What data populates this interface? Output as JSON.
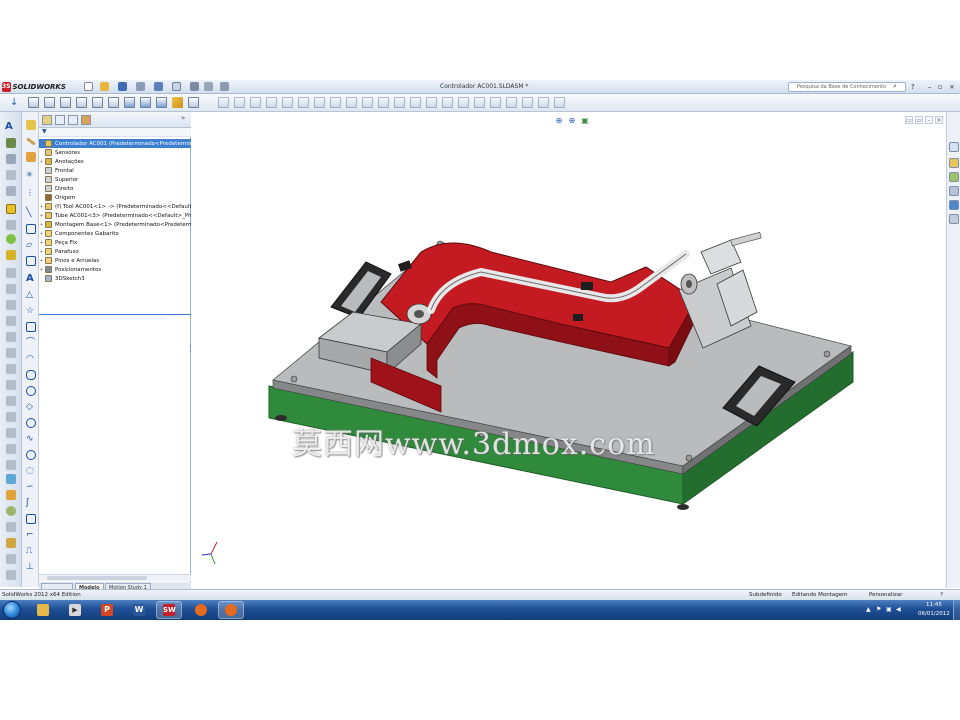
{
  "app": {
    "name": "SOLIDWORKS",
    "document_title": "Controlador AC001.SLDASM *",
    "search_placeholder": "Pesquisa da Base de Conhecimento",
    "help_label": "?"
  },
  "feature_tree": {
    "items": [
      {
        "label": "Controlador AC001  (Predeterminado<Predeterminado",
        "icon": "assembly-icon",
        "selected": true,
        "expand": ""
      },
      {
        "label": "Sensores",
        "icon": "sensors-folder-icon",
        "selected": false,
        "expand": ""
      },
      {
        "label": "Anotações",
        "icon": "annotations-icon",
        "selected": false,
        "expand": "+"
      },
      {
        "label": "Frontal",
        "icon": "plane-icon",
        "selected": false,
        "expand": ""
      },
      {
        "label": "Superior",
        "icon": "plane-icon",
        "selected": false,
        "expand": ""
      },
      {
        "label": "Direito",
        "icon": "plane-icon",
        "selected": false,
        "expand": ""
      },
      {
        "label": "Origem",
        "icon": "origin-icon",
        "selected": false,
        "expand": ""
      },
      {
        "label": "(f) Tool AC001<1> -> (Predeterminado<<Default",
        "icon": "part-icon",
        "selected": false,
        "expand": "+"
      },
      {
        "label": "Tube AC001<3> (Predeterminado<<Default>_Ph",
        "icon": "part-icon",
        "selected": false,
        "expand": "+"
      },
      {
        "label": "Montagem Base<1> (Predeterminado<Predeterm",
        "icon": "subassembly-icon",
        "selected": false,
        "expand": "+"
      },
      {
        "label": "Componentes Gabarito",
        "icon": "folder-icon",
        "selected": false,
        "expand": "+"
      },
      {
        "label": "Peça Fix",
        "icon": "folder-icon",
        "selected": false,
        "expand": "+"
      },
      {
        "label": "Parafuso",
        "icon": "folder-icon",
        "selected": false,
        "expand": "+"
      },
      {
        "label": "Pinos e Arruelas",
        "icon": "folder-icon",
        "selected": false,
        "expand": "+"
      },
      {
        "label": "Posicionamentos",
        "icon": "mates-icon",
        "selected": false,
        "expand": "+"
      },
      {
        "label": "3DSketch3",
        "icon": "sketch-icon",
        "selected": false,
        "expand": ""
      }
    ]
  },
  "bottom_tabs": {
    "model": "Modelo",
    "motion": "Motion Study 1"
  },
  "status_bar": {
    "edition": "SolidWorks 2012 x64 Edition",
    "state": "Subdefinido",
    "mode": "Editando Montagem",
    "customize": "Personalizar"
  },
  "taskbar": {
    "time": "11:45",
    "date": "06/01/2012"
  },
  "watermark": "莫西网www.3dmox.com",
  "colors": {
    "fixture_red": "#b3141d",
    "base_plate_green": "#2f8a3c",
    "plate_gray": "#b9bbbd",
    "selection_blue": "#3c7fd0"
  }
}
